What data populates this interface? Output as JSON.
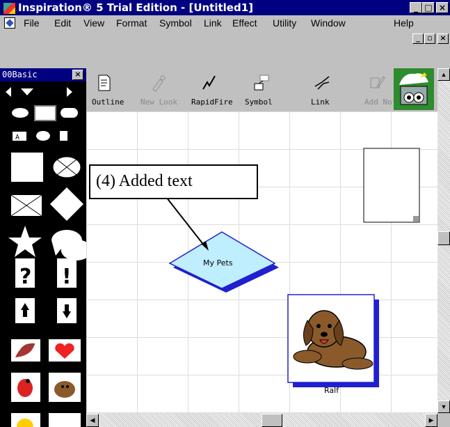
{
  "window": {
    "title": "Inspiration® 5 Trial Edition - [Untitled1]",
    "minimize": "_",
    "maximize": "□",
    "close": "×"
  },
  "menu": {
    "items": [
      "File",
      "Edit",
      "View",
      "Format",
      "Symbol",
      "Link",
      "Effect",
      "Utility",
      "Window",
      "Help"
    ]
  },
  "palette": {
    "title": "00Basic"
  },
  "toolbar": {
    "buttons": [
      "Outline",
      "New Look",
      "RapidFire",
      "Symbol",
      "Link",
      "Add Not"
    ]
  },
  "diagram": {
    "central_node": "My Pets",
    "image_node_label": "Ralf"
  },
  "annotation": {
    "callout": "(4) Added text"
  },
  "colors": {
    "titlebar": "#000080",
    "diamond_fill": "#bfeeff",
    "diamond_shadow": "#2020d0",
    "dog_brown": "#8b5a2b"
  }
}
